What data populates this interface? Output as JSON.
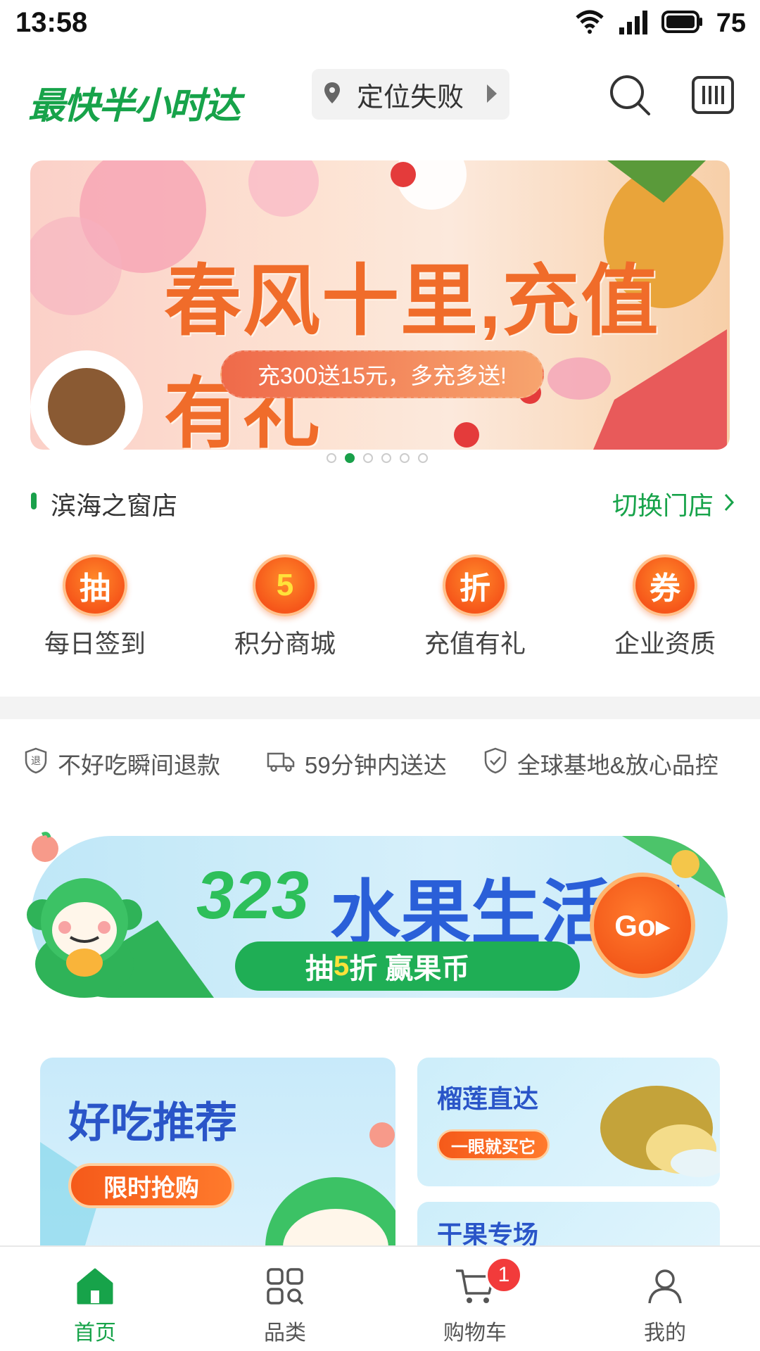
{
  "status_bar": {
    "time": "13:58",
    "battery": "75"
  },
  "header": {
    "logo_text": "最快半小时达",
    "location_label": "定位失败"
  },
  "banner": {
    "title": "春风十里,充值有礼",
    "subtitle": "充300送15元，多充多送!",
    "dot_count": 6,
    "active_dot": 2
  },
  "store": {
    "name": "滨海之窗店",
    "switch_label": "切换门店"
  },
  "quick_actions": [
    {
      "glyph": "抽",
      "label": "每日签到"
    },
    {
      "glyph": "5",
      "label": "积分商城"
    },
    {
      "glyph": "折",
      "label": "充值有礼"
    },
    {
      "glyph": "券",
      "label": "企业资质"
    }
  ],
  "promises": [
    {
      "icon": "refund-shield-icon",
      "text": "不好吃瞬间退款"
    },
    {
      "icon": "truck-icon",
      "text": "59分钟内送达"
    },
    {
      "icon": "check-shield-icon",
      "text": "全球基地&放心品控"
    }
  ],
  "festival": {
    "number": "323",
    "title": "水果生活节",
    "pill_prefix": "抽",
    "pill_highlight": "5",
    "pill_suffix": "折 赢果币",
    "go_label": "Go▸"
  },
  "cards": {
    "big": {
      "title": "好吃推荐",
      "pill": "限时抢购"
    },
    "durian": {
      "title": "榴莲直达",
      "pill": "一眼就买它"
    },
    "nuts": {
      "title": "干果专场"
    }
  },
  "tabbar": {
    "tabs": [
      {
        "label": "首页",
        "icon": "home-icon",
        "active": true
      },
      {
        "label": "品类",
        "icon": "category-icon",
        "active": false
      },
      {
        "label": "购物车",
        "icon": "cart-icon",
        "active": false
      },
      {
        "label": "我的",
        "icon": "profile-icon",
        "active": false
      }
    ],
    "cart_badge": "1"
  },
  "colors": {
    "brand_green": "#17a34a",
    "accent_orange": "#f6561a",
    "badge_red": "#f23b3b"
  }
}
